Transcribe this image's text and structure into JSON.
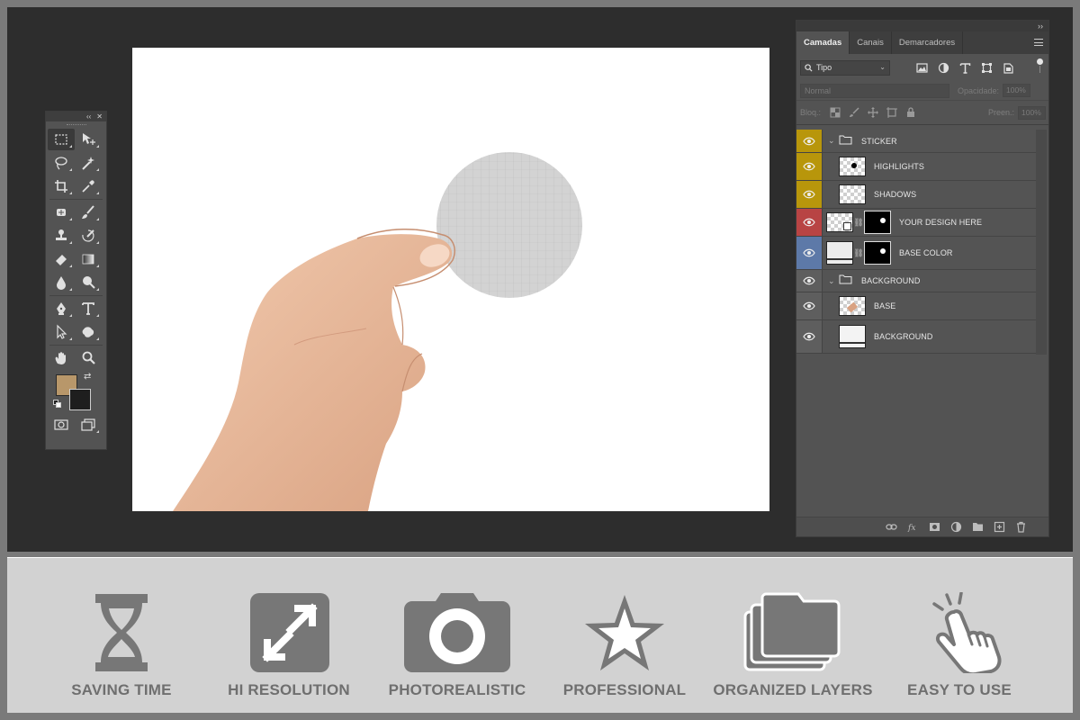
{
  "tools_panel": {
    "collapse_glyph": "‹‹",
    "close_glyph": "✕",
    "tools": [
      [
        "marquee-icon",
        "move-icon"
      ],
      [
        "lasso-icon",
        "magic-wand-icon"
      ],
      [
        "crop-icon",
        "eyedropper-icon"
      ],
      [
        "healing-brush-icon",
        "brush-icon"
      ],
      [
        "clone-stamp-icon",
        "history-brush-icon"
      ],
      [
        "eraser-icon",
        "gradient-icon"
      ],
      [
        "blur-icon",
        "dodge-icon"
      ],
      [
        "pen-icon",
        "type-icon"
      ],
      [
        "path-selection-icon",
        "shape-icon"
      ],
      [
        "hand-icon",
        "zoom-icon"
      ]
    ],
    "foreground_color": "#b8976a",
    "background_color": "#1e1e1e",
    "swap_glyph": "⇄"
  },
  "layers_panel": {
    "expand_glyph": "››",
    "tabs": [
      {
        "label": "Camadas",
        "active": true
      },
      {
        "label": "Canais",
        "active": false
      },
      {
        "label": "Demarcadores",
        "active": false
      }
    ],
    "filter_label": "Tipo",
    "blend_mode": "Normal",
    "opacity_label": "Opacidade:",
    "opacity_value": "100%",
    "lock_label": "Bloq.:",
    "fill_label": "Preen.:",
    "fill_value": "100%",
    "layers": [
      {
        "name": "STICKER",
        "kind": "group",
        "color": "yellow"
      },
      {
        "name": "HIGHLIGHTS",
        "kind": "layer",
        "color": "yellow"
      },
      {
        "name": "SHADOWS",
        "kind": "layer",
        "color": "yellow"
      },
      {
        "name": "YOUR DESIGN HERE",
        "kind": "smart-masked",
        "color": "red"
      },
      {
        "name": "BASE COLOR",
        "kind": "fill-masked",
        "color": "blue"
      },
      {
        "name": "BACKGROUND",
        "kind": "group",
        "color": "gray"
      },
      {
        "name": "BASE",
        "kind": "layer",
        "color": "gray"
      },
      {
        "name": "BACKGROUND",
        "kind": "layer",
        "color": "gray"
      }
    ]
  },
  "features": [
    {
      "label": "SAVING TIME",
      "icon": "hourglass-icon"
    },
    {
      "label": "HI RESOLUTION",
      "icon": "expand-arrows-icon"
    },
    {
      "label": "PHOTOREALISTIC",
      "icon": "camera-icon"
    },
    {
      "label": "PROFESSIONAL",
      "icon": "star-icon"
    },
    {
      "label": "ORGANIZED LAYERS",
      "icon": "stacked-folders-icon"
    },
    {
      "label": "EASY TO USE",
      "icon": "tap-hand-icon"
    }
  ],
  "colors": {
    "workspace": "#2d2d2d",
    "panel": "#535353",
    "feature_bar": "#d2d2d2",
    "feature_icon": "#777777",
    "label_yellow": "#b8960b",
    "label_red": "#b84444",
    "label_blue": "#5d79a8"
  }
}
